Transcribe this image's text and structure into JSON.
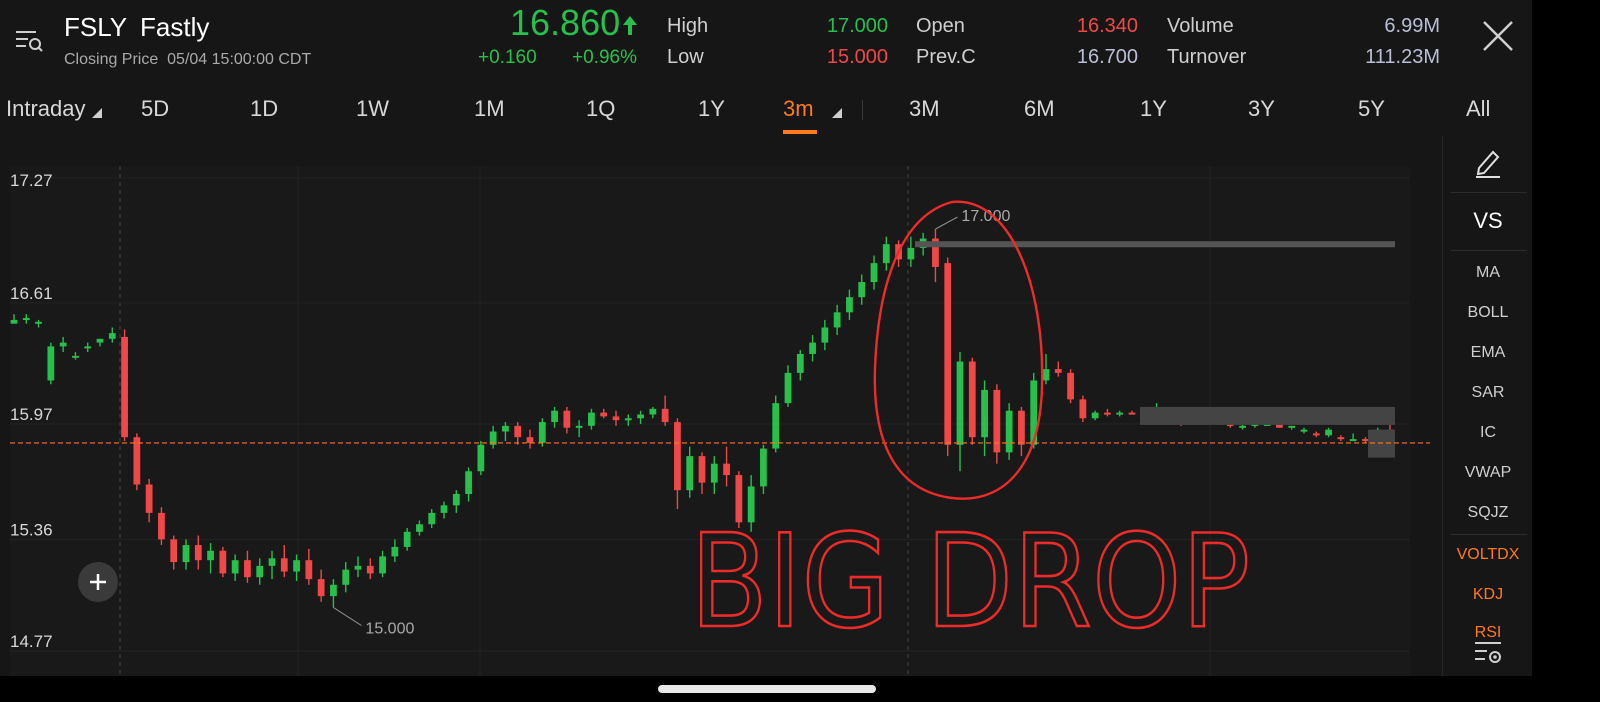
{
  "header": {
    "symbol": "FSLY",
    "company": "Fastly",
    "closing_label": "Closing Price",
    "closing_time": "05/04 15:00:00 CDT",
    "price": "16.860",
    "change": "+0.160",
    "change_pct": "+0.96%",
    "stats": {
      "high_label": "High",
      "high_value": "17.000",
      "low_label": "Low",
      "low_value": "15.000",
      "open_label": "Open",
      "open_value": "16.340",
      "prevc_label": "Prev.C",
      "prevc_value": "16.700",
      "volume_label": "Volume",
      "volume_value": "6.99M",
      "turnover_label": "Turnover",
      "turnover_value": "111.23M"
    },
    "colors": {
      "up": "#27c04c",
      "down": "#f04848",
      "accent": "#ff7a1a"
    }
  },
  "tabs": [
    "Intraday",
    "5D",
    "1D",
    "1W",
    "1M",
    "1Q",
    "1Y",
    "3m",
    "3M",
    "6M",
    "1Y",
    "3Y",
    "5Y",
    "All"
  ],
  "active_tab": "3m",
  "indicators": [
    "MA",
    "BOLL",
    "EMA",
    "SAR",
    "IC",
    "VWAP",
    "SQJZ",
    "VOLTDX",
    "KDJ",
    "RSI"
  ],
  "side_top": {
    "compare_label": "VS"
  },
  "annotation": {
    "text": "BIG DROP"
  },
  "chart_data": {
    "type": "candlestick",
    "y_ticks": [
      "17.27",
      "16.61",
      "15.97",
      "15.36",
      "14.77"
    ],
    "ylim": [
      14.77,
      17.27
    ],
    "high_label": "17.000",
    "low_label": "15.000",
    "reference_line": 15.97,
    "series": [
      {
        "o": 16.5,
        "h": 16.55,
        "l": 16.5,
        "c": 16.52
      },
      {
        "o": 16.52,
        "h": 16.55,
        "l": 16.5,
        "c": 16.53
      },
      {
        "o": 16.5,
        "h": 16.52,
        "l": 16.48,
        "c": 16.51
      },
      {
        "o": 16.2,
        "h": 16.4,
        "l": 16.18,
        "c": 16.38
      },
      {
        "o": 16.38,
        "h": 16.43,
        "l": 16.35,
        "c": 16.4
      },
      {
        "o": 16.33,
        "h": 16.35,
        "l": 16.31,
        "c": 16.33
      },
      {
        "o": 16.38,
        "h": 16.4,
        "l": 16.35,
        "c": 16.38
      },
      {
        "o": 16.4,
        "h": 16.42,
        "l": 16.38,
        "c": 16.42
      },
      {
        "o": 16.42,
        "h": 16.48,
        "l": 16.4,
        "c": 16.45
      },
      {
        "o": 16.43,
        "h": 16.47,
        "l": 15.88,
        "c": 15.9
      },
      {
        "o": 15.9,
        "h": 15.92,
        "l": 15.62,
        "c": 15.65
      },
      {
        "o": 15.65,
        "h": 15.68,
        "l": 15.45,
        "c": 15.5
      },
      {
        "o": 15.5,
        "h": 15.53,
        "l": 15.33,
        "c": 15.36
      },
      {
        "o": 15.36,
        "h": 15.38,
        "l": 15.2,
        "c": 15.24
      },
      {
        "o": 15.24,
        "h": 15.36,
        "l": 15.2,
        "c": 15.33
      },
      {
        "o": 15.33,
        "h": 15.38,
        "l": 15.2,
        "c": 15.25
      },
      {
        "o": 15.25,
        "h": 15.34,
        "l": 15.18,
        "c": 15.3
      },
      {
        "o": 15.3,
        "h": 15.32,
        "l": 15.16,
        "c": 15.18
      },
      {
        "o": 15.18,
        "h": 15.28,
        "l": 15.14,
        "c": 15.25
      },
      {
        "o": 15.25,
        "h": 15.3,
        "l": 15.13,
        "c": 15.16
      },
      {
        "o": 15.16,
        "h": 15.26,
        "l": 15.12,
        "c": 15.22
      },
      {
        "o": 15.22,
        "h": 15.3,
        "l": 15.15,
        "c": 15.26
      },
      {
        "o": 15.26,
        "h": 15.33,
        "l": 15.16,
        "c": 15.19
      },
      {
        "o": 15.19,
        "h": 15.28,
        "l": 15.14,
        "c": 15.25
      },
      {
        "o": 15.25,
        "h": 15.31,
        "l": 15.12,
        "c": 15.15
      },
      {
        "o": 15.15,
        "h": 15.2,
        "l": 15.03,
        "c": 15.06
      },
      {
        "o": 15.06,
        "h": 15.15,
        "l": 15.0,
        "c": 15.12
      },
      {
        "o": 15.12,
        "h": 15.24,
        "l": 15.08,
        "c": 15.2
      },
      {
        "o": 15.2,
        "h": 15.27,
        "l": 15.16,
        "c": 15.22
      },
      {
        "o": 15.22,
        "h": 15.26,
        "l": 15.15,
        "c": 15.18
      },
      {
        "o": 15.18,
        "h": 15.3,
        "l": 15.16,
        "c": 15.27
      },
      {
        "o": 15.27,
        "h": 15.36,
        "l": 15.24,
        "c": 15.32
      },
      {
        "o": 15.32,
        "h": 15.42,
        "l": 15.3,
        "c": 15.4
      },
      {
        "o": 15.4,
        "h": 15.46,
        "l": 15.38,
        "c": 15.44
      },
      {
        "o": 15.44,
        "h": 15.52,
        "l": 15.42,
        "c": 15.5
      },
      {
        "o": 15.5,
        "h": 15.56,
        "l": 15.47,
        "c": 15.54
      },
      {
        "o": 15.54,
        "h": 15.62,
        "l": 15.5,
        "c": 15.6
      },
      {
        "o": 15.6,
        "h": 15.74,
        "l": 15.56,
        "c": 15.72
      },
      {
        "o": 15.72,
        "h": 15.88,
        "l": 15.7,
        "c": 15.86
      },
      {
        "o": 15.86,
        "h": 15.96,
        "l": 15.84,
        "c": 15.93
      },
      {
        "o": 15.93,
        "h": 15.98,
        "l": 15.88,
        "c": 15.96
      },
      {
        "o": 15.96,
        "h": 15.98,
        "l": 15.86,
        "c": 15.9
      },
      {
        "o": 15.9,
        "h": 15.94,
        "l": 15.84,
        "c": 15.87
      },
      {
        "o": 15.87,
        "h": 16.0,
        "l": 15.85,
        "c": 15.98
      },
      {
        "o": 15.98,
        "h": 16.06,
        "l": 15.95,
        "c": 16.04
      },
      {
        "o": 16.04,
        "h": 16.06,
        "l": 15.92,
        "c": 15.95
      },
      {
        "o": 15.95,
        "h": 15.99,
        "l": 15.9,
        "c": 15.96
      },
      {
        "o": 15.96,
        "h": 16.05,
        "l": 15.94,
        "c": 16.03
      },
      {
        "o": 16.03,
        "h": 16.05,
        "l": 16.0,
        "c": 16.01
      },
      {
        "o": 16.01,
        "h": 16.04,
        "l": 15.96,
        "c": 15.99
      },
      {
        "o": 15.99,
        "h": 16.02,
        "l": 15.96,
        "c": 16.0
      },
      {
        "o": 16.0,
        "h": 16.04,
        "l": 15.97,
        "c": 16.02
      },
      {
        "o": 16.02,
        "h": 16.06,
        "l": 16.0,
        "c": 16.05
      },
      {
        "o": 16.05,
        "h": 16.12,
        "l": 15.96,
        "c": 15.98
      },
      {
        "o": 15.98,
        "h": 16.0,
        "l": 15.52,
        "c": 15.62
      },
      {
        "o": 15.62,
        "h": 15.85,
        "l": 15.58,
        "c": 15.8
      },
      {
        "o": 15.8,
        "h": 15.82,
        "l": 15.6,
        "c": 15.66
      },
      {
        "o": 15.66,
        "h": 15.8,
        "l": 15.6,
        "c": 15.76
      },
      {
        "o": 15.76,
        "h": 15.85,
        "l": 15.64,
        "c": 15.7
      },
      {
        "o": 15.7,
        "h": 15.72,
        "l": 15.42,
        "c": 15.45
      },
      {
        "o": 15.45,
        "h": 15.7,
        "l": 15.4,
        "c": 15.64
      },
      {
        "o": 15.64,
        "h": 15.86,
        "l": 15.6,
        "c": 15.84
      },
      {
        "o": 15.84,
        "h": 16.12,
        "l": 15.82,
        "c": 16.08
      },
      {
        "o": 16.08,
        "h": 16.28,
        "l": 16.06,
        "c": 16.24
      },
      {
        "o": 16.24,
        "h": 16.36,
        "l": 16.2,
        "c": 16.34
      },
      {
        "o": 16.34,
        "h": 16.44,
        "l": 16.3,
        "c": 16.4
      },
      {
        "o": 16.4,
        "h": 16.52,
        "l": 16.36,
        "c": 16.48
      },
      {
        "o": 16.48,
        "h": 16.6,
        "l": 16.44,
        "c": 16.56
      },
      {
        "o": 16.56,
        "h": 16.68,
        "l": 16.52,
        "c": 16.64
      },
      {
        "o": 16.64,
        "h": 16.76,
        "l": 16.6,
        "c": 16.72
      },
      {
        "o": 16.72,
        "h": 16.86,
        "l": 16.68,
        "c": 16.82
      },
      {
        "o": 16.82,
        "h": 16.96,
        "l": 16.78,
        "c": 16.92
      },
      {
        "o": 16.92,
        "h": 16.94,
        "l": 16.8,
        "c": 16.84
      },
      {
        "o": 16.84,
        "h": 16.96,
        "l": 16.8,
        "c": 16.9
      },
      {
        "o": 16.9,
        "h": 16.98,
        "l": 16.86,
        "c": 16.95
      },
      {
        "o": 16.95,
        "h": 17.0,
        "l": 16.72,
        "c": 16.8
      },
      {
        "o": 16.82,
        "h": 16.85,
        "l": 15.8,
        "c": 15.86
      },
      {
        "o": 15.86,
        "h": 16.35,
        "l": 15.72,
        "c": 16.3
      },
      {
        "o": 16.3,
        "h": 16.32,
        "l": 15.86,
        "c": 15.9
      },
      {
        "o": 15.9,
        "h": 16.2,
        "l": 15.8,
        "c": 16.15
      },
      {
        "o": 16.15,
        "h": 16.18,
        "l": 15.76,
        "c": 15.82
      },
      {
        "o": 15.82,
        "h": 16.08,
        "l": 15.78,
        "c": 16.04
      },
      {
        "o": 16.04,
        "h": 16.06,
        "l": 15.8,
        "c": 15.86
      },
      {
        "o": 15.86,
        "h": 16.24,
        "l": 15.84,
        "c": 16.2
      },
      {
        "o": 16.2,
        "h": 16.34,
        "l": 16.18,
        "c": 16.26
      },
      {
        "o": 16.26,
        "h": 16.3,
        "l": 16.22,
        "c": 16.24
      },
      {
        "o": 16.24,
        "h": 16.26,
        "l": 16.08,
        "c": 16.1
      },
      {
        "o": 16.1,
        "h": 16.12,
        "l": 15.98,
        "c": 16.0
      },
      {
        "o": 16.0,
        "h": 16.04,
        "l": 15.99,
        "c": 16.03
      },
      {
        "o": 16.03,
        "h": 16.05,
        "l": 16.01,
        "c": 16.02
      },
      {
        "o": 16.02,
        "h": 16.04,
        "l": 16.01,
        "c": 16.03
      },
      {
        "o": 16.03,
        "h": 16.04,
        "l": 16.02,
        "c": 16.02
      },
      {
        "o": 16.02,
        "h": 16.03,
        "l": 16.01,
        "c": 16.02
      },
      {
        "o": 16.02,
        "h": 16.08,
        "l": 16.01,
        "c": 16.03
      },
      {
        "o": 16.03,
        "h": 16.04,
        "l": 15.99,
        "c": 16.0
      },
      {
        "o": 16.0,
        "h": 16.01,
        "l": 15.96,
        "c": 15.98
      },
      {
        "o": 15.98,
        "h": 15.99,
        "l": 15.97,
        "c": 15.98
      },
      {
        "o": 15.98,
        "h": 15.99,
        "l": 15.97,
        "c": 15.98
      },
      {
        "o": 15.98,
        "h": 15.99,
        "l": 15.97,
        "c": 15.97
      },
      {
        "o": 15.97,
        "h": 15.98,
        "l": 15.95,
        "c": 15.96
      },
      {
        "o": 15.96,
        "h": 15.97,
        "l": 15.94,
        "c": 15.96
      },
      {
        "o": 15.96,
        "h": 15.97,
        "l": 15.95,
        "c": 15.97
      },
      {
        "o": 15.97,
        "h": 15.98,
        "l": 15.96,
        "c": 15.97
      },
      {
        "o": 15.97,
        "h": 15.98,
        "l": 15.95,
        "c": 15.95
      },
      {
        "o": 15.95,
        "h": 15.96,
        "l": 15.94,
        "c": 15.96
      },
      {
        "o": 15.94,
        "h": 15.95,
        "l": 15.92,
        "c": 15.94
      },
      {
        "o": 15.92,
        "h": 15.93,
        "l": 15.9,
        "c": 15.91
      },
      {
        "o": 15.91,
        "h": 15.95,
        "l": 15.9,
        "c": 15.94
      },
      {
        "o": 15.9,
        "h": 15.91,
        "l": 15.88,
        "c": 15.89
      },
      {
        "o": 15.89,
        "h": 15.92,
        "l": 15.88,
        "c": 15.89
      },
      {
        "o": 15.89,
        "h": 15.9,
        "l": 15.87,
        "c": 15.88
      },
      {
        "o": 15.92,
        "h": 15.95,
        "l": 15.9,
        "c": 15.94
      },
      {
        "o": 15.94,
        "h": 15.99,
        "l": 15.9,
        "c": 15.92
      }
    ]
  }
}
